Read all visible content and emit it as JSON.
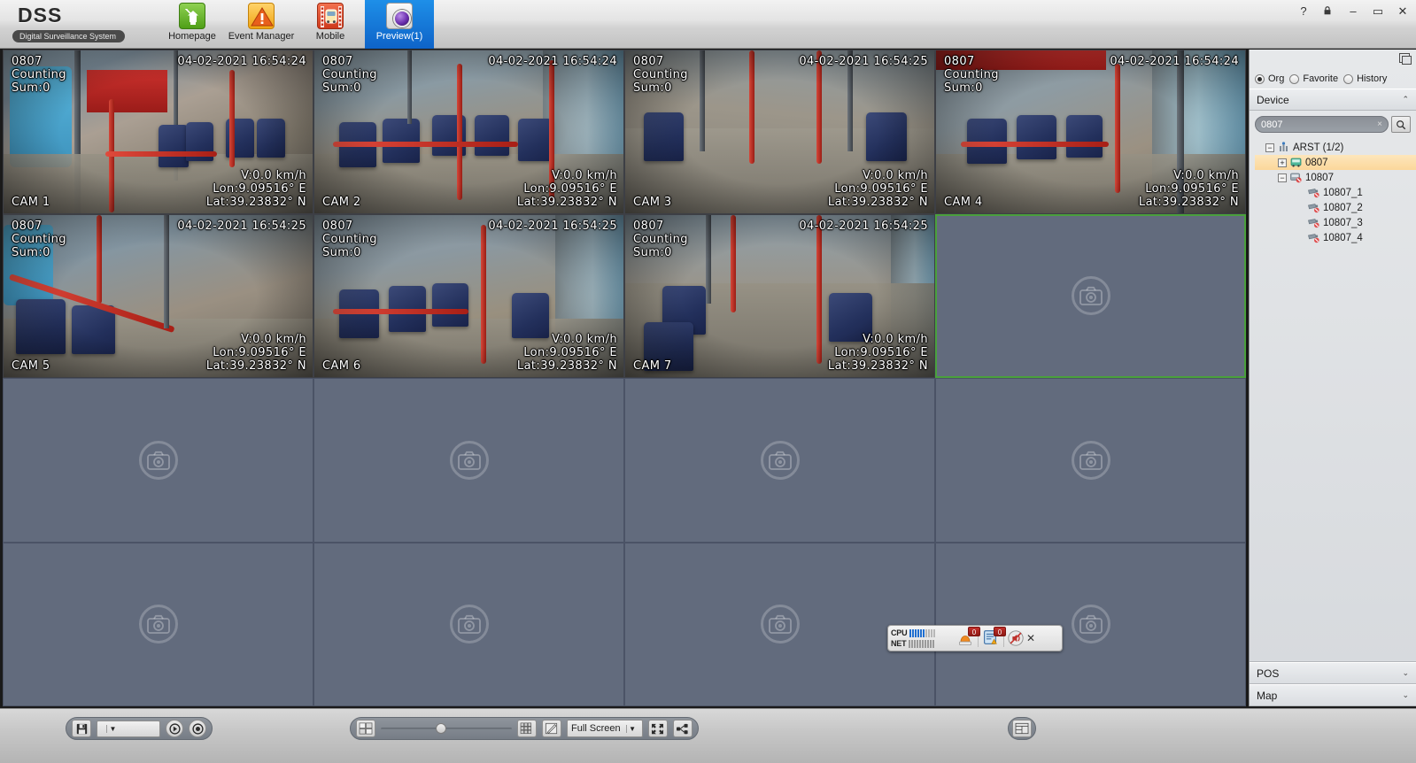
{
  "app": {
    "logo": "DSS",
    "logo_subtitle": "Digital Surveillance System"
  },
  "header": {
    "tabs": [
      {
        "label": "Homepage",
        "icon": "home-icon",
        "active": false
      },
      {
        "label": "Event Manager",
        "icon": "warning-icon",
        "active": false
      },
      {
        "label": "Mobile",
        "icon": "bus-film-icon",
        "active": false
      },
      {
        "label": "Preview(1)",
        "icon": "preview-icon",
        "active": true
      }
    ],
    "window_controls": [
      {
        "name": "help-button",
        "glyph": "?"
      },
      {
        "name": "lock-button",
        "glyph": "■"
      },
      {
        "name": "minimize-button",
        "glyph": "–"
      },
      {
        "name": "maximize-button",
        "glyph": "▭"
      },
      {
        "name": "close-button",
        "glyph": "✕"
      }
    ]
  },
  "grid": {
    "rows": 4,
    "columns": 4,
    "selected_index": 7,
    "cells": [
      {
        "index": 0,
        "live": true,
        "device": "0807",
        "mode": "Counting",
        "sum": "Sum:0",
        "timestamp": "04-02-2021  16:54:24",
        "speed": "V:0.0 km/h",
        "lon": "Lon:9.09516° E",
        "lat": "Lat:39.23832° N",
        "channel": "CAM 1"
      },
      {
        "index": 1,
        "live": true,
        "device": "0807",
        "mode": "Counting",
        "sum": "Sum:0",
        "timestamp": "04-02-2021  16:54:24",
        "speed": "V:0.0 km/h",
        "lon": "Lon:9.09516° E",
        "lat": "Lat:39.23832° N",
        "channel": "CAM 2"
      },
      {
        "index": 2,
        "live": true,
        "device": "0807",
        "mode": "Counting",
        "sum": "Sum:0",
        "timestamp": "04-02-2021  16:54:25",
        "speed": "V:0.0 km/h",
        "lon": "Lon:9.09516° E",
        "lat": "Lat:39.23832° N",
        "channel": "CAM 3"
      },
      {
        "index": 3,
        "live": true,
        "device": "0807",
        "mode": "Counting",
        "sum": "Sum:0",
        "timestamp": "04-02-2021  16:54:24",
        "speed": "V:0.0 km/h",
        "lon": "Lon:9.09516° E",
        "lat": "Lat:39.23832° N",
        "channel": "CAM 4"
      },
      {
        "index": 4,
        "live": true,
        "device": "0807",
        "mode": "Counting",
        "sum": "Sum:0",
        "timestamp": "04-02-2021  16:54:25",
        "speed": "V:0.0 km/h",
        "lon": "Lon:9.09516° E",
        "lat": "Lat:39.23832° N",
        "channel": "CAM 5"
      },
      {
        "index": 5,
        "live": true,
        "device": "0807",
        "mode": "Counting",
        "sum": "Sum:0",
        "timestamp": "04-02-2021  16:54:25",
        "speed": "V:0.0 km/h",
        "lon": "Lon:9.09516° E",
        "lat": "Lat:39.23832° N",
        "channel": "CAM 6"
      },
      {
        "index": 6,
        "live": true,
        "device": "0807",
        "mode": "Counting",
        "sum": "Sum:0",
        "timestamp": "04-02-2021  16:54:25",
        "speed": "V:0.0 km/h",
        "lon": "Lon:9.09516° E",
        "lat": "Lat:39.23832° N",
        "channel": "CAM 7"
      },
      {
        "index": 7,
        "live": false,
        "placeholder_icon": "camera-icon"
      },
      {
        "index": 8,
        "live": false,
        "placeholder_icon": "camera-icon"
      },
      {
        "index": 9,
        "live": false,
        "placeholder_icon": "camera-icon"
      },
      {
        "index": 10,
        "live": false,
        "placeholder_icon": "camera-icon"
      },
      {
        "index": 11,
        "live": false,
        "placeholder_icon": "camera-icon"
      },
      {
        "index": 12,
        "live": false,
        "placeholder_icon": "camera-icon"
      },
      {
        "index": 13,
        "live": false,
        "placeholder_icon": "camera-icon"
      },
      {
        "index": 14,
        "live": false,
        "placeholder_icon": "camera-icon"
      },
      {
        "index": 15,
        "live": false,
        "placeholder_icon": "camera-icon"
      }
    ]
  },
  "status_widget": {
    "cpu_label": "CPU",
    "net_label": "NET",
    "cpu_bars_on": 6,
    "cpu_bars_total": 10,
    "net_bars_on": 0,
    "net_bars_total": 10,
    "alarm_badge": "0",
    "event_badge": "0",
    "alarm_icon": "alarm-light-icon",
    "event_icon": "event-list-icon",
    "mute_icon": "speaker-mute-icon",
    "close_glyph": "✕"
  },
  "toolbar": {
    "left": {
      "save_icon": "save-icon",
      "preset_value": "",
      "preset_arrow": "▼",
      "tour_start_icon": "tour-start-icon",
      "tour_stop_icon": "tour-stop-icon"
    },
    "center": {
      "layout_icon": "split-layout-icon",
      "slider_value": 42,
      "grid_icon": "grid-layout-icon",
      "edit_icon": "edit-layout-icon",
      "screen_mode": "Full Screen",
      "screen_arrow": "▼",
      "fullscreen_icon": "fullscreen-icon",
      "multiscreen_icon": "multi-monitor-icon"
    },
    "right": {
      "window_icon": "window-list-icon"
    }
  },
  "sidebar": {
    "dock_icon": "dock-panel-icon",
    "sources": [
      {
        "label": "Org",
        "selected": true
      },
      {
        "label": "Favorite",
        "selected": false
      },
      {
        "label": "History",
        "selected": false
      }
    ],
    "device_section": {
      "title": "Device",
      "collapse_glyph": "⌃",
      "search_value": "0807",
      "search_clear_glyph": "×",
      "search_icon": "search-icon"
    },
    "tree": [
      {
        "label": "ARST (1/2)",
        "depth": 0,
        "expander": "−",
        "icon": "org-tower-icon",
        "selected": false
      },
      {
        "label": "0807",
        "depth": 1,
        "expander": "+",
        "icon": "bus-online-icon",
        "selected": true
      },
      {
        "label": "10807",
        "depth": 1,
        "expander": "−",
        "icon": "bus-offline-icon",
        "selected": false
      },
      {
        "label": "10807_1",
        "depth": 2,
        "expander": "",
        "icon": "camera-offline-icon",
        "selected": false
      },
      {
        "label": "10807_2",
        "depth": 2,
        "expander": "",
        "icon": "camera-offline-icon",
        "selected": false
      },
      {
        "label": "10807_3",
        "depth": 2,
        "expander": "",
        "icon": "camera-offline-icon",
        "selected": false
      },
      {
        "label": "10807_4",
        "depth": 2,
        "expander": "",
        "icon": "camera-offline-icon",
        "selected": false
      }
    ],
    "bottom_sections": [
      {
        "title": "POS",
        "collapse_glyph": "⌄"
      },
      {
        "title": "Map",
        "collapse_glyph": "⌄"
      }
    ]
  },
  "colors": {
    "accent_tab": "#0e63c8",
    "selected_cell_border": "#4aa03c",
    "tree_selected": "#fbd79a",
    "badge_red": "#c4302b",
    "cpu_bar": "#1f6fd0"
  }
}
